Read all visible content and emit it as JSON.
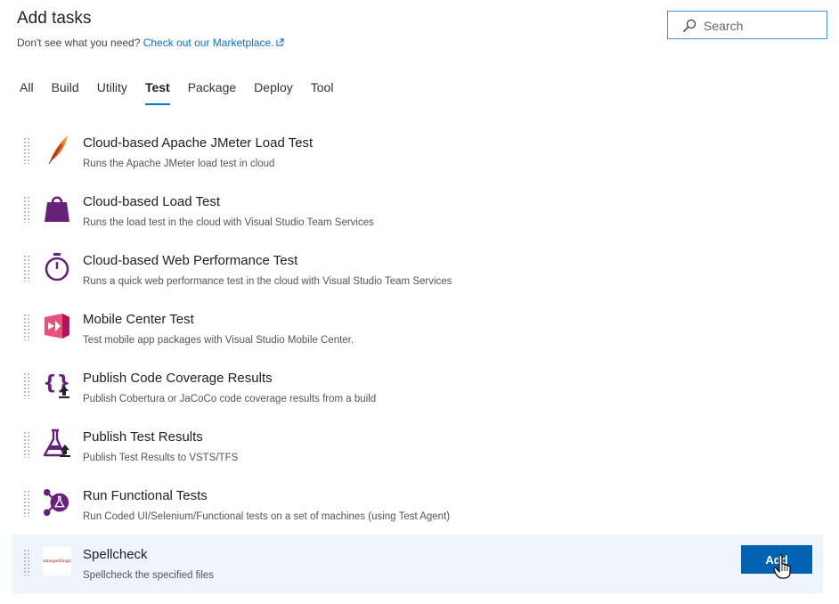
{
  "header": {
    "title": "Add tasks",
    "subtitle_prefix": "Don't see what you need? ",
    "marketplace_link": "Check out our Marketplace."
  },
  "search": {
    "placeholder": "Search"
  },
  "tabs": [
    {
      "label": "All"
    },
    {
      "label": "Build"
    },
    {
      "label": "Utility"
    },
    {
      "label": "Test",
      "active": true
    },
    {
      "label": "Package"
    },
    {
      "label": "Deploy"
    },
    {
      "label": "Tool"
    }
  ],
  "tasks": [
    {
      "name": "Cloud-based Apache JMeter Load Test",
      "description": "Runs the Apache JMeter load test in cloud",
      "icon": "feather-icon"
    },
    {
      "name": "Cloud-based Load Test",
      "description": "Runs the load test in the cloud with Visual Studio Team Services",
      "icon": "weight-icon"
    },
    {
      "name": "Cloud-based Web Performance Test",
      "description": "Runs a quick web performance test in the cloud with Visual Studio Team Services",
      "icon": "stopwatch-icon"
    },
    {
      "name": "Mobile Center Test",
      "description": "Test mobile app packages with Visual Studio Mobile Center.",
      "icon": "visual-studio-icon"
    },
    {
      "name": "Publish Code Coverage Results",
      "description": "Publish Cobertura or JaCoCo code coverage results from a build",
      "icon": "braces-upload-icon"
    },
    {
      "name": "Publish Test Results",
      "description": "Publish Test Results to VSTS/TFS",
      "icon": "flask-upload-icon"
    },
    {
      "name": "Run Functional Tests",
      "description": "Run Coded UI/Selenium/Functional tests on a set of machines (using Test Agent)",
      "icon": "network-flask-icon"
    },
    {
      "name": "Spellcheck",
      "description": "Spellcheck the specified files",
      "icon": "spellcheck-logo-icon",
      "selected": true,
      "logo_text": "misspellings"
    }
  ],
  "add_button_label": "Add",
  "colors": {
    "accent": "#0078d4",
    "button": "#0063b1",
    "purple": "#68217a",
    "selected_row": "#eef4fb"
  }
}
